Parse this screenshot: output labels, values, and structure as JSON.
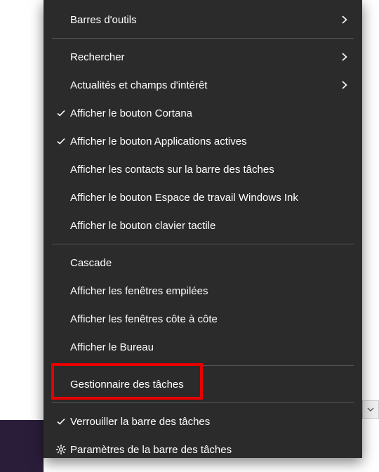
{
  "menu": {
    "items": [
      {
        "label": "Barres d'outils",
        "checked": false,
        "hasSubmenu": true,
        "icon": null,
        "sepAfter": true
      },
      {
        "label": "Rechercher",
        "checked": false,
        "hasSubmenu": true,
        "icon": null,
        "sepAfter": false
      },
      {
        "label": "Actualités et champs d'intérêt",
        "checked": false,
        "hasSubmenu": true,
        "icon": null,
        "sepAfter": false
      },
      {
        "label": "Afficher le bouton Cortana",
        "checked": true,
        "hasSubmenu": false,
        "icon": null,
        "sepAfter": false
      },
      {
        "label": "Afficher le bouton Applications actives",
        "checked": true,
        "hasSubmenu": false,
        "icon": null,
        "sepAfter": false
      },
      {
        "label": "Afficher les contacts sur la barre des tâches",
        "checked": false,
        "hasSubmenu": false,
        "icon": null,
        "sepAfter": false
      },
      {
        "label": "Afficher le bouton Espace de travail Windows Ink",
        "checked": false,
        "hasSubmenu": false,
        "icon": null,
        "sepAfter": false
      },
      {
        "label": "Afficher le bouton clavier tactile",
        "checked": false,
        "hasSubmenu": false,
        "icon": null,
        "sepAfter": true
      },
      {
        "label": "Cascade",
        "checked": false,
        "hasSubmenu": false,
        "icon": null,
        "sepAfter": false
      },
      {
        "label": "Afficher les fenêtres empilées",
        "checked": false,
        "hasSubmenu": false,
        "icon": null,
        "sepAfter": false
      },
      {
        "label": "Afficher les fenêtres côte à côte",
        "checked": false,
        "hasSubmenu": false,
        "icon": null,
        "sepAfter": false
      },
      {
        "label": "Afficher le Bureau",
        "checked": false,
        "hasSubmenu": false,
        "icon": null,
        "sepAfter": true
      },
      {
        "label": "Gestionnaire des tâches",
        "checked": false,
        "hasSubmenu": false,
        "icon": null,
        "sepAfter": true
      },
      {
        "label": "Verrouiller la barre des tâches",
        "checked": true,
        "hasSubmenu": false,
        "icon": null,
        "sepAfter": false
      },
      {
        "label": "Paramètres de la barre des tâches",
        "checked": false,
        "hasSubmenu": false,
        "icon": "gear",
        "sepAfter": false
      }
    ]
  },
  "highlightedIndex": 12
}
